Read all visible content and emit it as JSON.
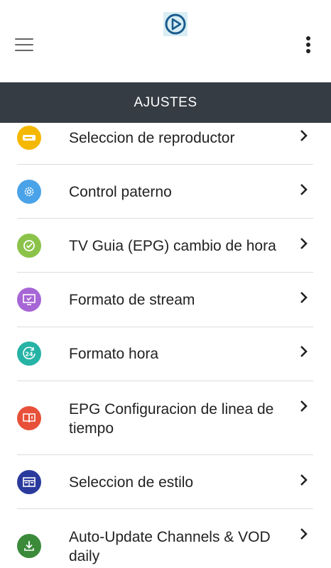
{
  "header": {
    "title": "AJUSTES"
  },
  "colors": {
    "titlebar_bg": "#353c44",
    "logo_accent": "#1a5c8e"
  },
  "settings": [
    {
      "label": "Seleccion de reproductor",
      "icon": "player-icon",
      "color": "#f5b800"
    },
    {
      "label": "Control paterno",
      "icon": "gear-icon",
      "color": "#4aa3e8"
    },
    {
      "label": "TV Guia (EPG) cambio de hora",
      "icon": "clock-check-icon",
      "color": "#8bc34a"
    },
    {
      "label": "Formato de stream",
      "icon": "monitor-icon",
      "color": "#a766d6"
    },
    {
      "label": "Formato hora",
      "icon": "24h-icon",
      "color": "#26b3a6"
    },
    {
      "label": "EPG Configuracion de linea de tiempo",
      "icon": "book-icon",
      "color": "#e8503a"
    },
    {
      "label": "Seleccion de estilo",
      "icon": "layout-icon",
      "color": "#2a3a9c"
    },
    {
      "label": "Auto-Update Channels & VOD daily",
      "icon": "download-icon",
      "color": "#3b8a3a"
    }
  ]
}
